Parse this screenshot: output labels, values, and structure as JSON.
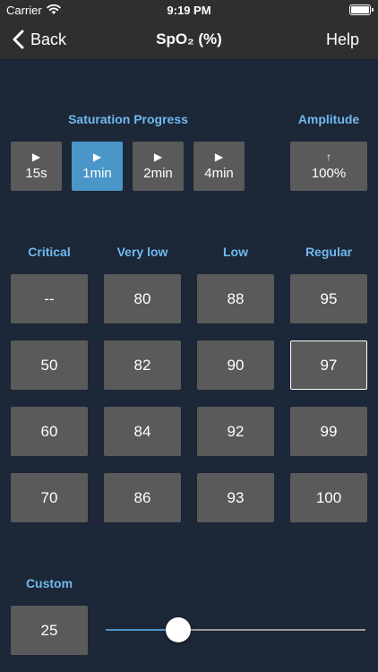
{
  "status_bar": {
    "carrier": "Carrier",
    "time": "9:19 PM"
  },
  "nav": {
    "back_label": "Back",
    "title": "SpO₂ (%)",
    "help_label": "Help"
  },
  "saturation": {
    "label": "Saturation Progress",
    "options": [
      {
        "icon": "▶",
        "label": "15s"
      },
      {
        "icon": "▶",
        "label": "1min",
        "selected": true
      },
      {
        "icon": "▶",
        "label": "2min"
      },
      {
        "icon": "▶",
        "label": "4min"
      }
    ]
  },
  "amplitude": {
    "label": "Amplitude",
    "icon": "↑",
    "value": "100%"
  },
  "columns": [
    {
      "label": "Critical",
      "values": [
        "--",
        "50",
        "60",
        "70"
      ]
    },
    {
      "label": "Very low",
      "values": [
        "80",
        "82",
        "84",
        "86"
      ]
    },
    {
      "label": "Low",
      "values": [
        "88",
        "90",
        "92",
        "93"
      ]
    },
    {
      "label": "Regular",
      "values": [
        "95",
        "97",
        "99",
        "100"
      ]
    }
  ],
  "selected_value": "97",
  "custom": {
    "label": "Custom",
    "value": "25",
    "slider_fraction": 0.28
  },
  "colors": {
    "accent": "#6fb9ef",
    "selected": "#4a96c8",
    "button": "#5a5a5a",
    "background": "#1c2737",
    "bar": "#2f2f2f"
  }
}
